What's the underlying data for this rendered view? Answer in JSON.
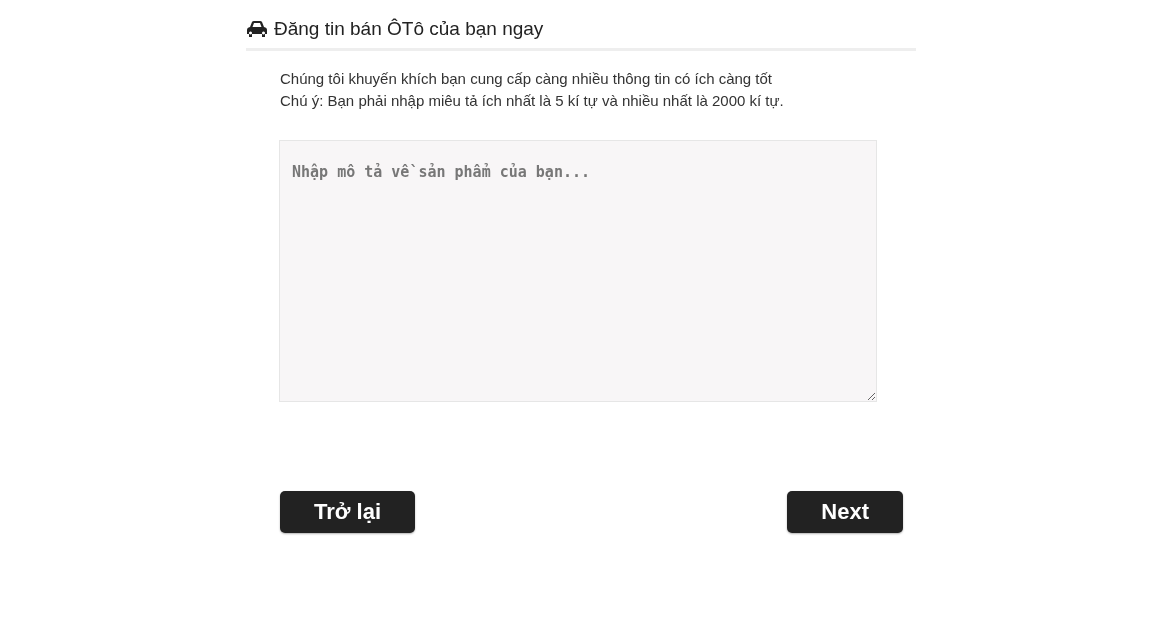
{
  "heading": "Đăng tin bán ÔTô của bạn ngay",
  "notes": [
    "Chúng tôi khuyến khích bạn cung cấp càng nhiều thông tin có ích càng tốt",
    "Chú ý: Bạn phải nhập miêu tả ích nhất là 5 kí tự và nhiều nhất là 2000 kí tự."
  ],
  "description": {
    "placeholder": "Nhập mô tả về sản phẩm của bạn..."
  },
  "buttons": [
    "Trở lại",
    "Next"
  ]
}
